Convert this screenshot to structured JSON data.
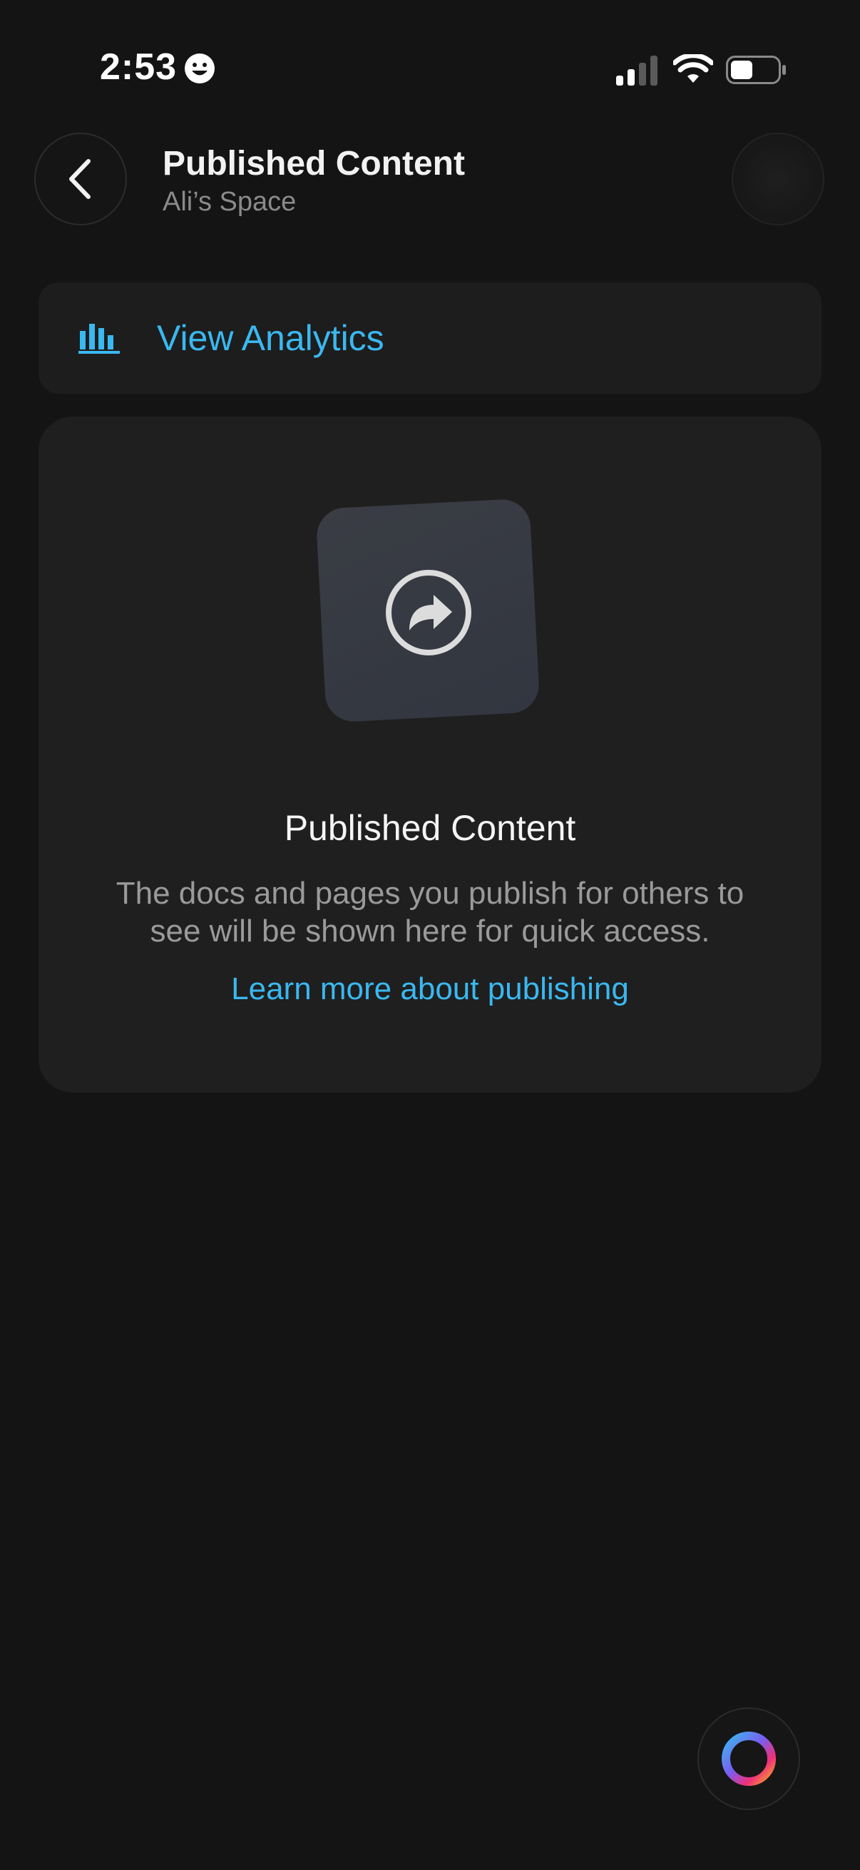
{
  "colors": {
    "background": "#141414",
    "accent": "#3ab8f0",
    "card": "#1f1f1f"
  },
  "status_bar": {
    "time": "2:53",
    "icons": [
      "smiley-icon",
      "cellular-signal-icon",
      "wifi-icon",
      "battery-icon"
    ]
  },
  "header": {
    "title": "Published Content",
    "subtitle": "Ali’s Space",
    "back_icon": "chevron-left-icon"
  },
  "analytics": {
    "label": "View Analytics",
    "icon": "bar-chart-icon"
  },
  "empty_state": {
    "icon": "share-arrow-icon",
    "title": "Published Content",
    "description": "The docs and pages you publish for others to see will be shown here for quick access.",
    "link": "Learn more about publishing"
  },
  "fab": {
    "icon": "ring-gradient-icon"
  }
}
